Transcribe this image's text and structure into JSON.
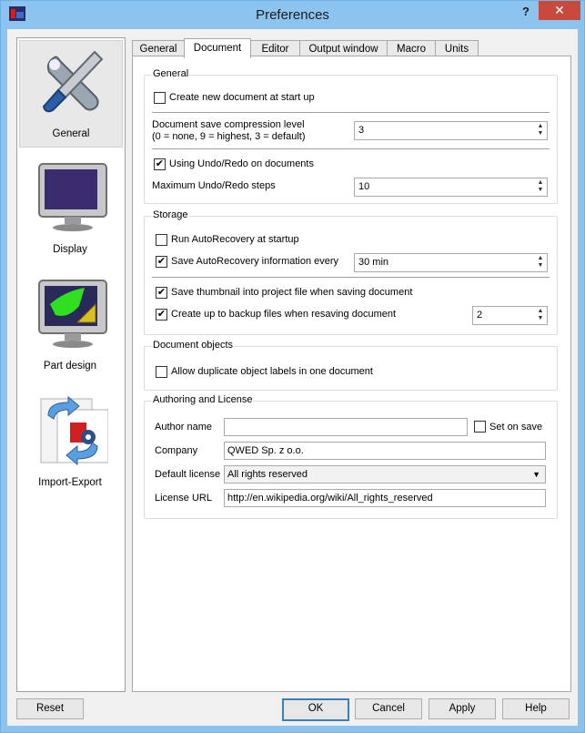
{
  "window": {
    "title": "Preferences",
    "help_label": "?",
    "close_label": "✕"
  },
  "categories": [
    {
      "label": "General"
    },
    {
      "label": "Display"
    },
    {
      "label": "Part design"
    },
    {
      "label": "Import-Export"
    }
  ],
  "tabs": [
    "General",
    "Document",
    "Editor",
    "Output window",
    "Macro",
    "Units"
  ],
  "general_group": {
    "title": "General",
    "create_new_doc": {
      "label": "Create new document at start up",
      "checked": false
    },
    "compression_label_1": "Document save compression level",
    "compression_label_2": "(0 = none, 9 = highest, 3 = default)",
    "compression_value": "3",
    "undo_redo": {
      "label": "Using Undo/Redo on documents",
      "checked": true
    },
    "max_undo_label": "Maximum Undo/Redo steps",
    "max_undo_value": "10"
  },
  "storage_group": {
    "title": "Storage",
    "run_autorecovery": {
      "label": "Run AutoRecovery at startup",
      "checked": false
    },
    "save_autorecovery": {
      "label": "Save AutoRecovery information every",
      "checked": true
    },
    "autorecovery_interval": "30 min",
    "save_thumbnail": {
      "label": "Save thumbnail into project file when saving document",
      "checked": true
    },
    "backup_files": {
      "label": "Create up to backup files when resaving document",
      "checked": true
    },
    "backup_count": "2"
  },
  "doc_objects_group": {
    "title": "Document objects",
    "allow_duplicate": {
      "label": "Allow duplicate object labels in one document",
      "checked": false
    }
  },
  "authoring_group": {
    "title": "Authoring and License",
    "author_label": "Author name",
    "author_value": "",
    "set_on_save": {
      "label": "Set on save",
      "checked": false
    },
    "company_label": "Company",
    "company_value": "QWED Sp. z o.o.",
    "license_label": "Default license",
    "license_value": "All rights reserved",
    "license_url_label": "License URL",
    "license_url_value": "http://en.wikipedia.org/wiki/All_rights_reserved"
  },
  "buttons": {
    "reset": "Reset",
    "ok": "OK",
    "cancel": "Cancel",
    "apply": "Apply",
    "help": "Help"
  },
  "colors": {
    "titlebar": "#8cc4ef",
    "close": "#c74a3d",
    "default_button_border": "#3c7fb1"
  }
}
